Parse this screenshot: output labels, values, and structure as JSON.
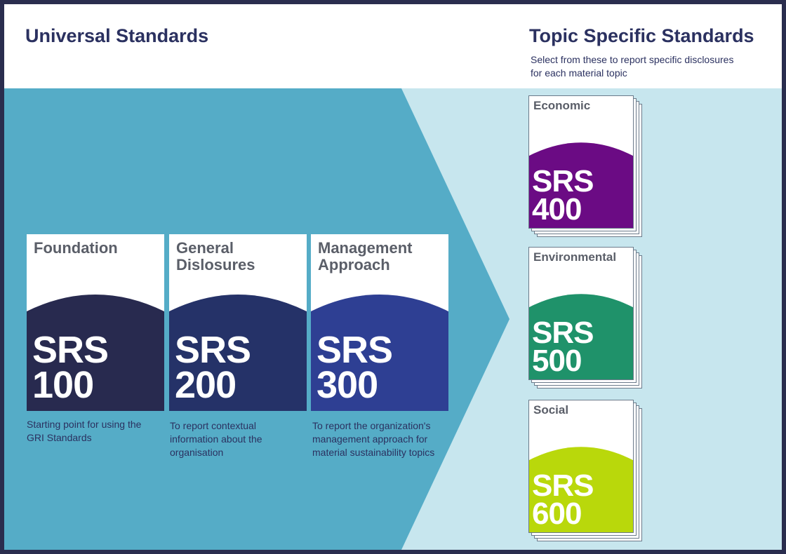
{
  "universal": {
    "title": "Universal Standards",
    "cards": [
      {
        "title_lines": [
          "Foundation"
        ],
        "srs": "SRS",
        "number": "100",
        "description": "Starting point for using the GRI Standards",
        "color": "#282a4f"
      },
      {
        "title_lines": [
          "General",
          "Dislosures"
        ],
        "srs": "SRS",
        "number": "200",
        "description": "To report contextual information about the organisation",
        "color": "#253268"
      },
      {
        "title_lines": [
          "Management",
          "Approach"
        ],
        "srs": "SRS",
        "number": "300",
        "description": "To report the organization's management approach for material sustainability topics",
        "color": "#2e3f93"
      }
    ]
  },
  "topic": {
    "title": "Topic Specific Standards",
    "subtitle": "Select from these to report specific disclosures for each material topic",
    "cards": [
      {
        "title": "Economic",
        "srs": "SRS",
        "number": "400",
        "color": "#6b0b84"
      },
      {
        "title": "Environmental",
        "srs": "SRS",
        "number": "500",
        "color": "#1f926a"
      },
      {
        "title": "Social",
        "srs": "SRS",
        "number": "600",
        "color": "#b9d80b"
      }
    ]
  },
  "colors": {
    "arrow": "#55acc7",
    "right_panel": "#c7e6ee",
    "heading": "#2b3160",
    "frame": "#2a2d4e"
  }
}
